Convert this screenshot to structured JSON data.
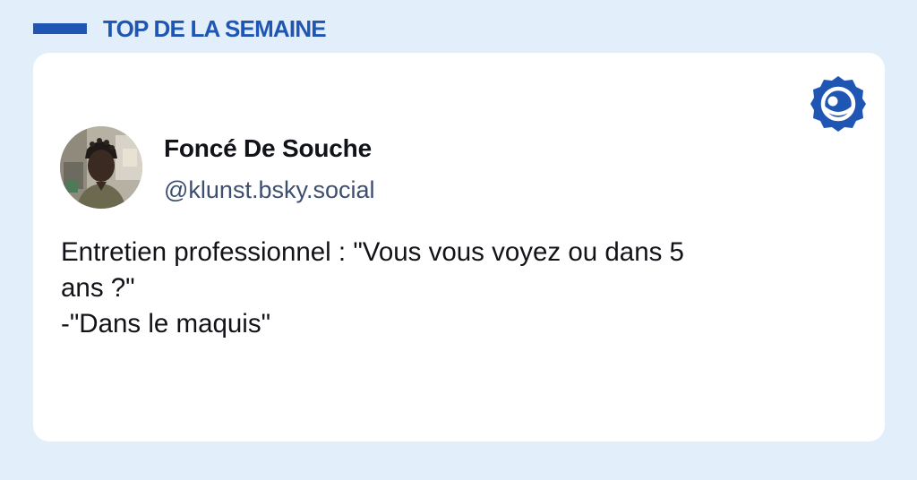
{
  "header": {
    "title": "TOP DE LA SEMAINE"
  },
  "post": {
    "author": {
      "display_name": "Foncé De Souche",
      "handle": "@klunst.bsky.social"
    },
    "text_lines": [
      "Entretien professionnel : \"Vous vous voyez ou dans 5",
      "ans ?\"",
      "-\"Dans le maquis\""
    ]
  },
  "icons": {
    "brand": "bluesky-butterfly-badge-icon",
    "avatar": "user-avatar-photo"
  },
  "colors": {
    "page_background": "#e3eefb",
    "accent": "#1f56b3",
    "card_background": "#ffffff",
    "handle_text": "#3d4e6e",
    "body_text": "#111318"
  }
}
